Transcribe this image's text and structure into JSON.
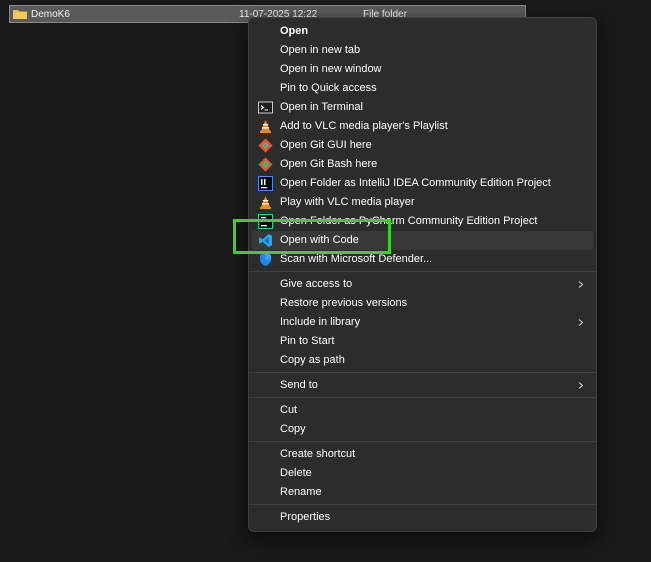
{
  "file_row": {
    "name": "DemoK6",
    "date": "11-07-2025 12:22",
    "type": "File folder"
  },
  "menu": {
    "items": [
      {
        "label": "Open",
        "icon": "none"
      },
      {
        "label": "Open in new tab",
        "icon": "none"
      },
      {
        "label": "Open in new window",
        "icon": "none"
      },
      {
        "label": "Pin to Quick access",
        "icon": "none"
      },
      {
        "label": "Open in Terminal",
        "icon": "terminal-icon"
      },
      {
        "label": "Add to VLC media player's Playlist",
        "icon": "vlc-icon"
      },
      {
        "label": "Open Git GUI here",
        "icon": "git-icon"
      },
      {
        "label": "Open Git Bash here",
        "icon": "git-icon"
      },
      {
        "label": "Open Folder as IntelliJ IDEA Community Edition Project",
        "icon": "intellij-icon"
      },
      {
        "label": "Play with VLC media player",
        "icon": "vlc-icon"
      },
      {
        "label": "Open Folder as PyCharm Community Edition Project",
        "icon": "pycharm-icon"
      },
      {
        "label": "Open with Code",
        "icon": "vscode-icon"
      },
      {
        "label": "Scan with Microsoft Defender...",
        "icon": "defender-icon"
      },
      {
        "label": "Give access to",
        "icon": "none"
      },
      {
        "label": "Restore previous versions",
        "icon": "none"
      },
      {
        "label": "Include in library",
        "icon": "none"
      },
      {
        "label": "Pin to Start",
        "icon": "none"
      },
      {
        "label": "Copy as path",
        "icon": "none"
      },
      {
        "label": "Send to",
        "icon": "none"
      },
      {
        "label": "Cut",
        "icon": "none"
      },
      {
        "label": "Copy",
        "icon": "none"
      },
      {
        "label": "Create shortcut",
        "icon": "none"
      },
      {
        "label": "Delete",
        "icon": "none"
      },
      {
        "label": "Rename",
        "icon": "none"
      },
      {
        "label": "Properties",
        "icon": "none"
      }
    ]
  },
  "colors": {
    "background": "#191919",
    "menu_background": "#2c2c2c",
    "hover_background": "#383838",
    "highlight_outline": "#3fd12b",
    "folder": "#e8b94a",
    "vscode_blue": "#23a9f2",
    "vlc_orange": "#f08a1c",
    "git_orange": "#f05133"
  }
}
